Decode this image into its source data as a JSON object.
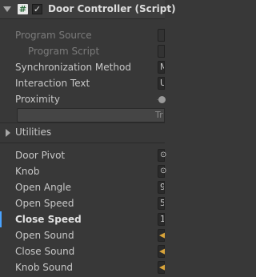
{
  "header": {
    "title": "Door Controller (Script)",
    "hash_glyph": "#",
    "check_glyph": "✓"
  },
  "fields": [
    {
      "label": "Program Source",
      "value": "",
      "disabled": true
    },
    {
      "label": "Program Script",
      "value": "",
      "disabled": true
    },
    {
      "label": "Synchronization Method",
      "value": "M"
    },
    {
      "label": "Interaction Text",
      "value": "U"
    },
    {
      "label": "Proximity",
      "value": ""
    }
  ],
  "slider_button_text": "Tr",
  "utilities_label": "Utilities",
  "props": [
    {
      "label": "Door Pivot",
      "value": ""
    },
    {
      "label": "Knob",
      "value": ""
    },
    {
      "label": "Open Angle",
      "value": "9"
    },
    {
      "label": "Open Speed",
      "value": "5"
    },
    {
      "label": "Close Speed",
      "value": "1"
    },
    {
      "label": "Open Sound",
      "value": ""
    },
    {
      "label": "Close Sound",
      "value": ""
    },
    {
      "label": "Knob Sound",
      "value": ""
    }
  ],
  "icons": {
    "object_field": "target-icon",
    "audio_field": "audio-clip-icon"
  }
}
